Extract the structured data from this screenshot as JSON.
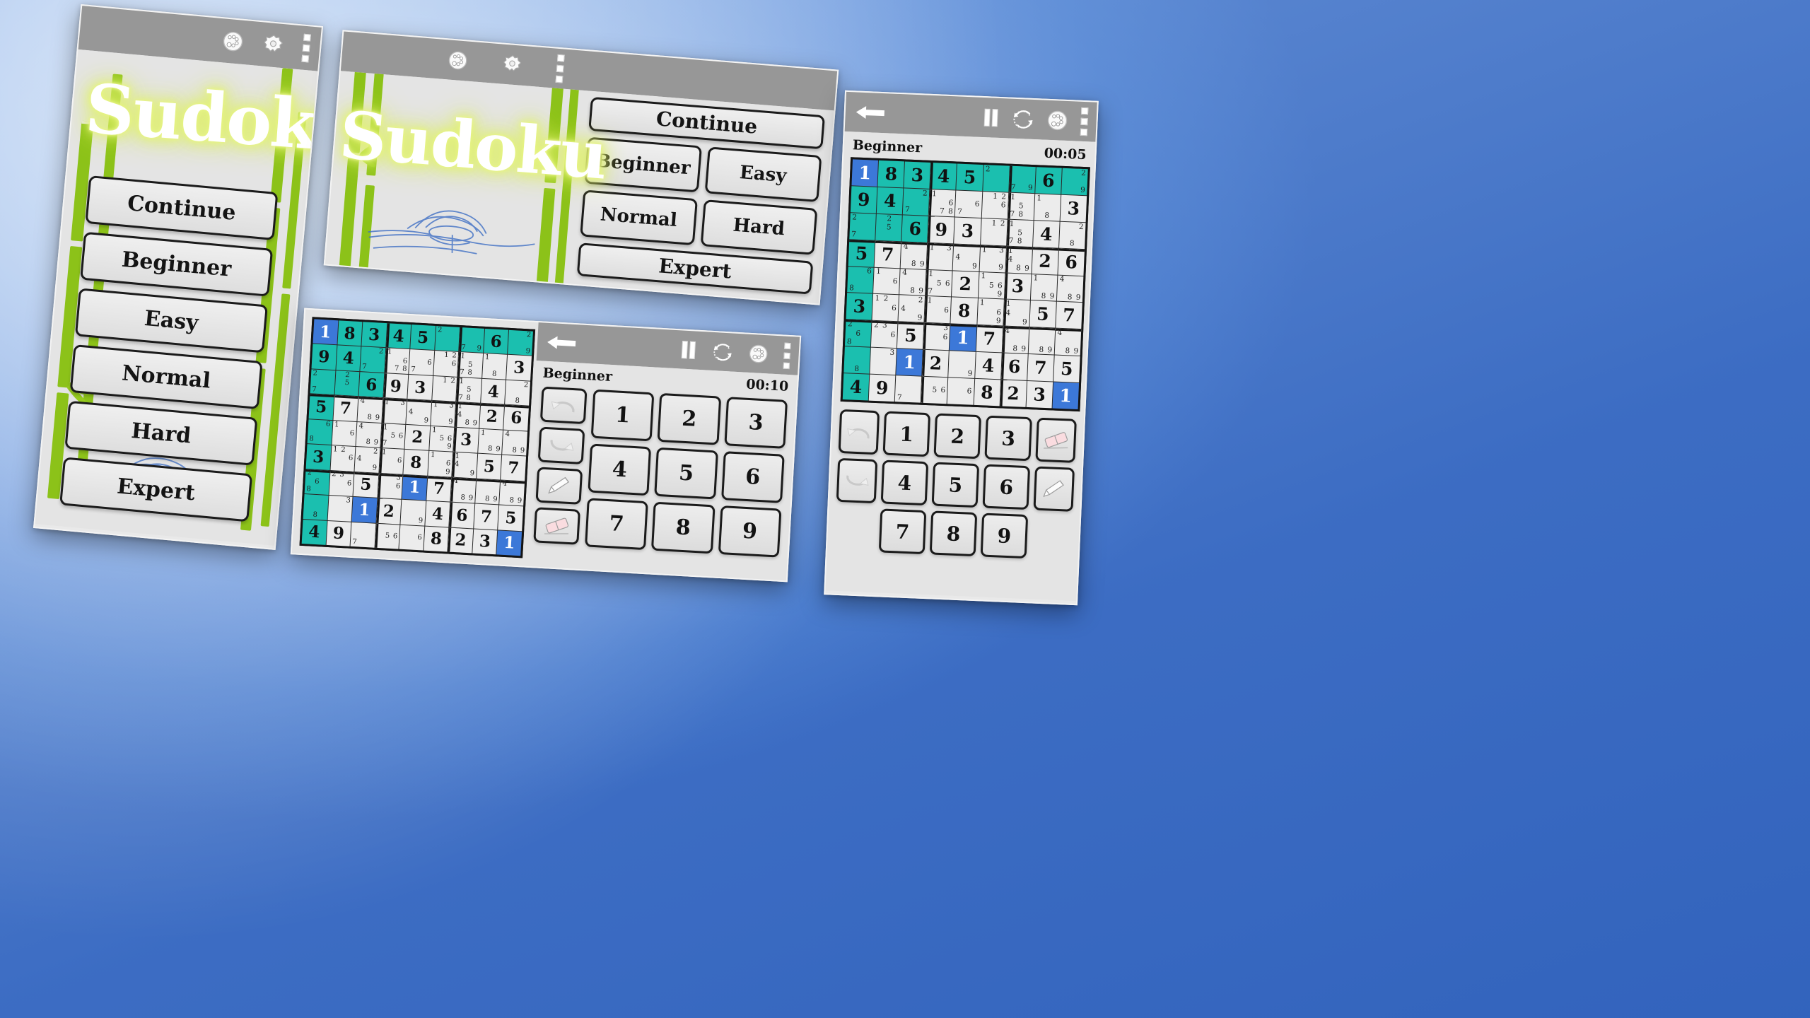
{
  "app": {
    "title": "Sudoku",
    "background_color": "#4c7fd0"
  },
  "menu": {
    "buttons": [
      "Continue",
      "Beginner",
      "Easy",
      "Normal",
      "Hard",
      "Expert"
    ],
    "continue_label": "Continue",
    "beginner_label": "Beginner",
    "easy_label": "Easy",
    "normal_label": "Normal",
    "hard_label": "Hard",
    "expert_label": "Expert"
  },
  "appbar": {
    "icons": [
      "awards-icon",
      "gear-icon",
      "overflow-menu-icon"
    ],
    "game_icons": [
      "back-arrow-icon",
      "pause-icon",
      "refresh-icon",
      "awards-icon",
      "overflow-menu-icon"
    ]
  },
  "game": {
    "difficulty_label": "Beginner",
    "timer_center": "00:10",
    "timer_right": "00:05",
    "numpad": [
      "1",
      "2",
      "3",
      "4",
      "5",
      "6",
      "7",
      "8",
      "9"
    ],
    "tools": [
      "undo-icon",
      "redo-icon",
      "pencil-icon",
      "eraser-icon"
    ]
  },
  "colors": {
    "given_cell": "#1bbfaf",
    "selected_cell": "#3c78d8",
    "appbar": "#979797",
    "bamboo": "#8cc219",
    "logo_glow": "#dff06a"
  },
  "board": {
    "rows": [
      [
        {
          "v": "1",
          "s": "sel"
        },
        {
          "v": "8",
          "s": "given"
        },
        {
          "v": "3",
          "s": "given"
        },
        {
          "v": "4",
          "s": "given"
        },
        {
          "v": "5",
          "s": "given"
        },
        {
          "n": [
            "2",
            "",
            "",
            "",
            "",
            "",
            "",
            "",
            ""
          ],
          "s": "given"
        },
        {
          "n": [
            "",
            "",
            "",
            "",
            "",
            "",
            "7",
            "",
            "9"
          ],
          "s": "given"
        },
        {
          "v": "6",
          "s": "given"
        },
        {
          "n": [
            "",
            "",
            "2",
            "",
            "",
            "",
            "",
            "",
            "9"
          ],
          "s": "given"
        }
      ],
      [
        {
          "v": "9",
          "s": "given"
        },
        {
          "v": "4",
          "s": "given"
        },
        {
          "n": [
            "",
            "",
            "2",
            "",
            "",
            "",
            "7",
            "",
            ""
          ],
          "s": "given"
        },
        {
          "n": [
            "1",
            "",
            "",
            "",
            "",
            "6",
            "",
            "7",
            "8"
          ]
        },
        {
          "n": [
            "",
            "",
            "",
            "",
            "",
            "6",
            "7",
            "",
            ""
          ]
        },
        {
          "n": [
            "",
            "1",
            "2",
            "",
            "",
            "6",
            "",
            "",
            ""
          ]
        },
        {
          "n": [
            "1",
            "",
            "",
            "",
            "5",
            "",
            "7",
            "8",
            ""
          ]
        },
        {
          "n": [
            "1",
            "",
            "",
            "",
            "",
            "",
            "",
            "8",
            ""
          ]
        },
        {
          "v": "3"
        }
      ],
      [
        {
          "n": [
            "2",
            "",
            "",
            "",
            "",
            "",
            "7",
            "",
            ""
          ],
          "s": "given"
        },
        {
          "n": [
            "",
            "2",
            "",
            "",
            "5",
            "",
            "",
            "",
            ""
          ],
          "s": "given"
        },
        {
          "v": "6",
          "s": "given"
        },
        {
          "v": "9"
        },
        {
          "v": "3"
        },
        {
          "n": [
            "",
            "1",
            "2",
            "",
            "",
            "",
            "",
            "",
            ""
          ]
        },
        {
          "n": [
            "1",
            "",
            "",
            "",
            "5",
            "",
            "7",
            "8",
            ""
          ]
        },
        {
          "v": "4"
        },
        {
          "n": [
            "",
            "",
            "2",
            "",
            "",
            "",
            "",
            "8",
            ""
          ]
        }
      ],
      [
        {
          "v": "5",
          "s": "given"
        },
        {
          "v": "7"
        },
        {
          "n": [
            "4",
            "",
            "",
            "",
            "",
            "",
            "",
            "8",
            "9"
          ]
        },
        {
          "n": [
            "1",
            "",
            "3",
            "",
            "",
            "",
            "",
            "",
            ""
          ]
        },
        {
          "n": [
            "",
            "",
            "",
            "4",
            "",
            "",
            "",
            "",
            "9"
          ]
        },
        {
          "n": [
            "1",
            "",
            "3",
            "",
            "",
            "",
            "",
            "",
            "9"
          ]
        },
        {
          "n": [
            "1",
            "",
            "",
            "4",
            "",
            "",
            "",
            "8",
            "9"
          ]
        },
        {
          "v": "2"
        },
        {
          "v": "6"
        }
      ],
      [
        {
          "n": [
            "",
            "",
            "6",
            "",
            "",
            "",
            "8",
            "",
            ""
          ],
          "s": "given"
        },
        {
          "n": [
            "1",
            "",
            "",
            "",
            "",
            "6",
            "",
            "",
            ""
          ]
        },
        {
          "n": [
            "4",
            "",
            "",
            "",
            "",
            "",
            "",
            "8",
            "9"
          ]
        },
        {
          "n": [
            "1",
            "",
            "",
            "",
            "5",
            "6",
            "7",
            "",
            ""
          ]
        },
        {
          "v": "2"
        },
        {
          "n": [
            "1",
            "",
            "",
            "",
            "5",
            "6",
            "",
            "",
            "9"
          ]
        },
        {
          "v": "3"
        },
        {
          "n": [
            "1",
            "",
            "",
            "",
            "",
            "",
            "",
            "8",
            "9"
          ]
        },
        {
          "n": [
            "4",
            "",
            "",
            "",
            "",
            "",
            "",
            "8",
            "9"
          ]
        }
      ],
      [
        {
          "v": "3",
          "s": "given"
        },
        {
          "n": [
            "1",
            "2",
            "",
            "",
            "",
            "6",
            "",
            "",
            ""
          ]
        },
        {
          "n": [
            "",
            "",
            "2",
            "4",
            "",
            "",
            "",
            "",
            "9"
          ]
        },
        {
          "n": [
            "1",
            "",
            "",
            "",
            "",
            "6",
            "",
            "",
            ""
          ]
        },
        {
          "v": "8"
        },
        {
          "n": [
            "1",
            "",
            "",
            "",
            "",
            "6",
            "",
            "",
            "9"
          ]
        },
        {
          "n": [
            "1",
            "",
            "",
            "4",
            "",
            "",
            "",
            "",
            "9"
          ]
        },
        {
          "v": "5"
        },
        {
          "v": "7"
        }
      ],
      [
        {
          "n": [
            "2",
            "",
            "",
            "",
            "6",
            "",
            "8",
            "",
            ""
          ],
          "s": "given"
        },
        {
          "n": [
            "2",
            "3",
            "",
            "",
            "",
            "6",
            "",
            "",
            ""
          ]
        },
        {
          "v": "5"
        },
        {
          "n": [
            "",
            "",
            "3",
            "",
            "",
            "6",
            "",
            "",
            ""
          ]
        },
        {
          "v": "1",
          "s": "sel"
        },
        {
          "v": "7"
        },
        {
          "n": [
            "4",
            "",
            "",
            "",
            "",
            "",
            "",
            "8",
            "9"
          ]
        },
        {
          "n": [
            "",
            "",
            "",
            "",
            "",
            "",
            "",
            "8",
            "9"
          ]
        },
        {
          "n": [
            "4",
            "",
            "",
            "",
            "",
            "",
            "",
            "8",
            "9"
          ]
        }
      ],
      [
        {
          "n": [
            "",
            "",
            "",
            "",
            "",
            "",
            "",
            "8",
            ""
          ],
          "s": "given"
        },
        {
          "n": [
            "",
            "",
            "3",
            "",
            "",
            "",
            "",
            "",
            ""
          ]
        },
        {
          "v": "1",
          "s": "sel"
        },
        {
          "v": "2"
        },
        {
          "n": [
            "",
            "",
            "",
            "",
            "",
            "",
            "",
            "",
            "9"
          ]
        },
        {
          "v": "4"
        },
        {
          "v": "6"
        },
        {
          "v": "7"
        },
        {
          "v": "5"
        }
      ],
      [
        {
          "v": "4",
          "s": "given"
        },
        {
          "v": "9"
        },
        {
          "n": [
            "",
            "",
            "",
            "",
            "",
            "",
            "7",
            "",
            ""
          ]
        },
        {
          "n": [
            "",
            "",
            "",
            "",
            "5",
            "6",
            "",
            "",
            ""
          ]
        },
        {
          "n": [
            "",
            "",
            "",
            "",
            "",
            "6",
            "",
            "",
            ""
          ]
        },
        {
          "v": "8"
        },
        {
          "v": "2"
        },
        {
          "v": "3"
        },
        {
          "v": "1",
          "s": "sel"
        }
      ]
    ]
  }
}
